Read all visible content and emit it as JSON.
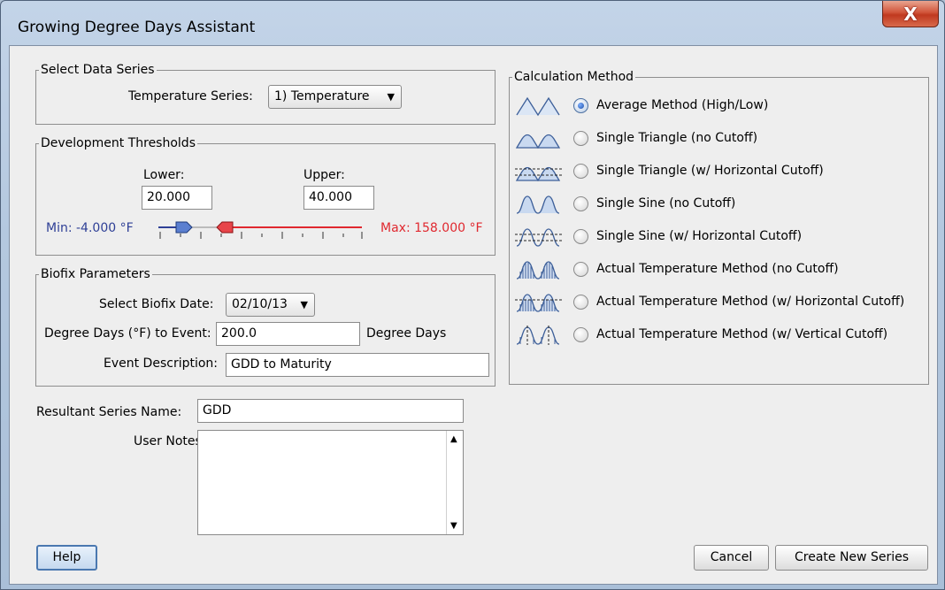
{
  "window": {
    "title": "Growing Degree Days Assistant",
    "close_glyph": "X"
  },
  "data_series": {
    "group_title": "Select Data Series",
    "temp_label": "Temperature Series:",
    "temp_value": "1) Temperature"
  },
  "thresholds": {
    "group_title": "Development Thresholds",
    "lower_label": "Lower:",
    "upper_label": "Upper:",
    "lower_value": "20.000",
    "upper_value": "40.000",
    "min_label": "Min: -4.000 °F",
    "max_label": "Max: 158.000 °F",
    "min_value": -4,
    "max_value": 158,
    "min_color": "#2e3f96",
    "max_color": "#e0282f"
  },
  "biofix": {
    "group_title": "Biofix Parameters",
    "date_label": "Select Biofix Date:",
    "date_value": "02/10/13",
    "dd_label": "Degree Days (°F) to Event:",
    "dd_value": "200.0",
    "dd_unit": "Degree Days",
    "event_label": "Event Description:",
    "event_value": "GDD to Maturity"
  },
  "resultant": {
    "name_label": "Resultant Series Name:",
    "name_value": "GDD",
    "notes_label": "User Notes:",
    "notes_value": ""
  },
  "calc_method": {
    "group_title": "Calculation Method",
    "methods": [
      {
        "label": "Average Method (High/Low)",
        "icon": "average-method-icon",
        "selected": true
      },
      {
        "label": "Single Triangle (no Cutoff)",
        "icon": "single-triangle-icon",
        "selected": false
      },
      {
        "label": "Single Triangle (w/ Horizontal Cutoff)",
        "icon": "single-triangle-cutoff-icon",
        "selected": false
      },
      {
        "label": "Single Sine (no Cutoff)",
        "icon": "single-sine-icon",
        "selected": false
      },
      {
        "label": "Single Sine (w/ Horizontal Cutoff)",
        "icon": "single-sine-cutoff-icon",
        "selected": false
      },
      {
        "label": "Actual Temperature Method (no Cutoff)",
        "icon": "actual-temp-icon",
        "selected": false
      },
      {
        "label": "Actual Temperature Method (w/ Horizontal Cutoff)",
        "icon": "actual-temp-hcutoff-icon",
        "selected": false
      },
      {
        "label": "Actual Temperature Method (w/ Vertical Cutoff)",
        "icon": "actual-temp-vcutoff-icon",
        "selected": false
      }
    ]
  },
  "buttons": {
    "help": "Help",
    "cancel": "Cancel",
    "create": "Create New Series"
  },
  "glyphs": {
    "dropdown": "▼",
    "scroll_up": "▲",
    "scroll_down": "▼"
  }
}
